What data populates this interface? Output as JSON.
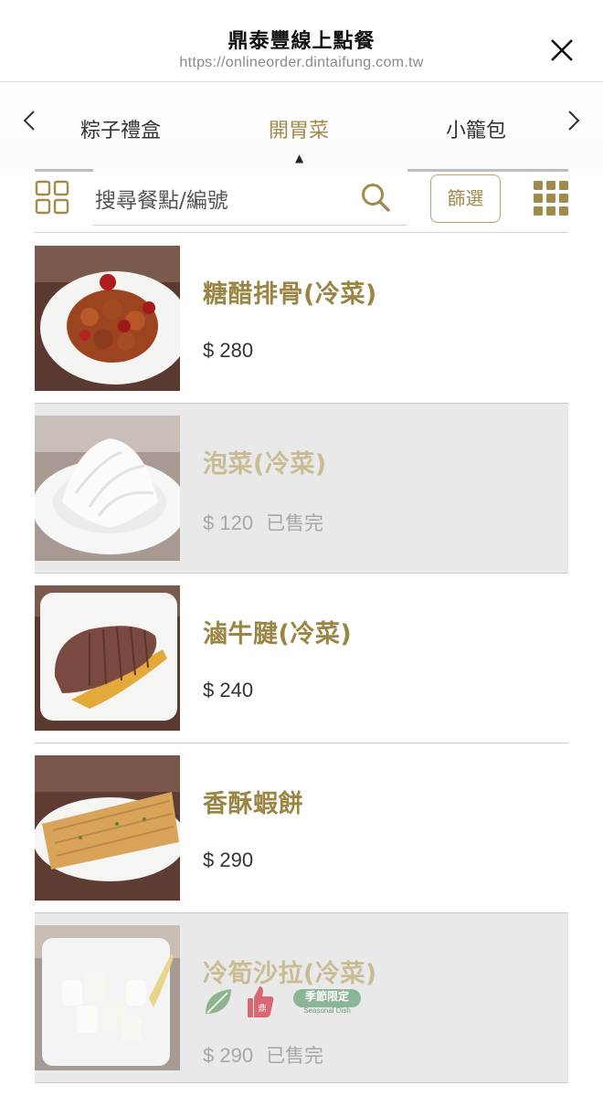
{
  "header": {
    "title": "鼎泰豐線上點餐",
    "url": "https://onlineorder.dintaifung.com.tw"
  },
  "categories": {
    "tabs": [
      {
        "label": "粽子禮盒"
      },
      {
        "label": "開胃菜"
      },
      {
        "label": "小籠包"
      }
    ],
    "active_index": 1
  },
  "search": {
    "placeholder": "搜尋餐點/編號",
    "filter_label": "篩選"
  },
  "menu_items": [
    {
      "name": "糖醋排骨(冷菜)",
      "price": "$ 280",
      "sold_out": false,
      "status": ""
    },
    {
      "name": "泡菜(冷菜)",
      "price": "$ 120",
      "sold_out": true,
      "status": "已售完"
    },
    {
      "name": "滷牛腱(冷菜)",
      "price": "$ 240",
      "sold_out": false,
      "status": ""
    },
    {
      "name": "香酥蝦餅",
      "price": "$ 290",
      "sold_out": false,
      "status": ""
    },
    {
      "name": "冷筍沙拉(冷菜)",
      "price": "$ 290",
      "sold_out": true,
      "status": "已售完",
      "tags": {
        "icons": [
          "leaf-icon",
          "thumbs-up-icon",
          "seasonal-badge"
        ],
        "seasonal_text": "季節限定",
        "seasonal_sub": "Seasonal Dish"
      }
    }
  ],
  "colors": {
    "accent": "#a08b4b",
    "accent_faded": "#c9bb94",
    "soldout_bg": "#e9e9e9",
    "leaf": "#8fb58e",
    "thumb": "#d9676f",
    "seasonal": "#8ab596"
  }
}
